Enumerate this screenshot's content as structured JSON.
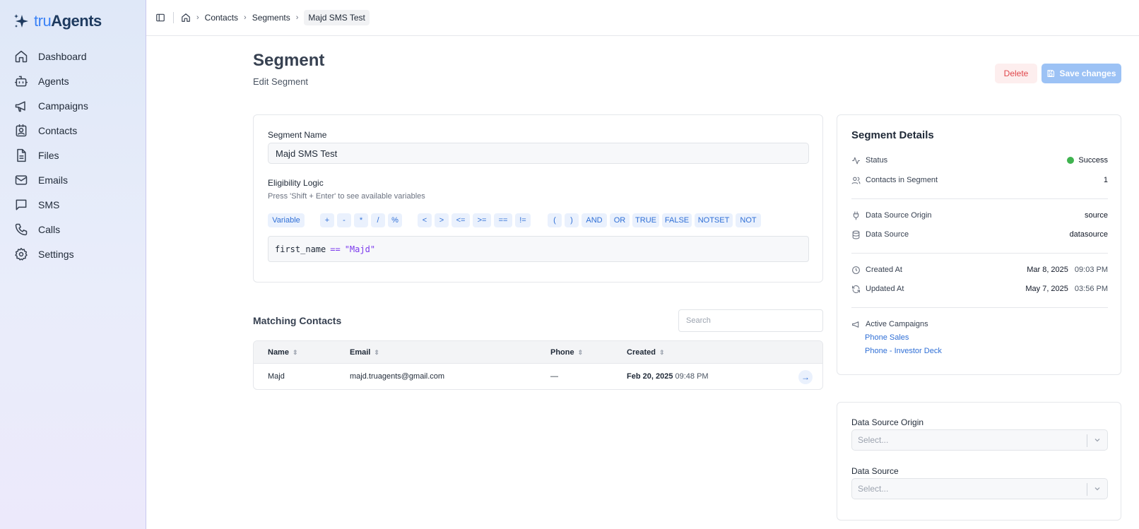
{
  "brand": {
    "tru": "tru",
    "agents": "Agents"
  },
  "nav": [
    {
      "label": "Dashboard",
      "icon": "home-icon"
    },
    {
      "label": "Agents",
      "icon": "bot-icon"
    },
    {
      "label": "Campaigns",
      "icon": "megaphone-icon"
    },
    {
      "label": "Contacts",
      "icon": "contact-card-icon"
    },
    {
      "label": "Files",
      "icon": "file-icon"
    },
    {
      "label": "Emails",
      "icon": "mail-icon"
    },
    {
      "label": "SMS",
      "icon": "message-icon"
    },
    {
      "label": "Calls",
      "icon": "phone-icon"
    },
    {
      "label": "Settings",
      "icon": "gear-icon"
    }
  ],
  "breadcrumb": {
    "contacts": "Contacts",
    "segments": "Segments",
    "current": "Majd SMS Test"
  },
  "header": {
    "title": "Segment",
    "subtitle": "Edit Segment",
    "delete_label": "Delete",
    "save_label": "Save changes"
  },
  "form": {
    "name_label": "Segment Name",
    "name_value": "Majd SMS Test",
    "logic_label": "Eligibility Logic",
    "logic_hint": "Press 'Shift + Enter' to see available variables",
    "tokens": [
      "Variable",
      "+",
      "-",
      "*",
      "/",
      "%",
      "<",
      ">",
      "<=",
      ">=",
      "==",
      "!=",
      "(",
      ")",
      "AND",
      "OR",
      "TRUE",
      "FALSE",
      "NOTSET",
      "NOT"
    ],
    "code": {
      "var": "first_name",
      "op": "==",
      "str": "\"Majd\""
    }
  },
  "contacts": {
    "title": "Matching Contacts",
    "search_placeholder": "Search",
    "columns": {
      "name": "Name",
      "email": "Email",
      "phone": "Phone",
      "created": "Created"
    },
    "rows": [
      {
        "name": "Majd",
        "email": "majd.truagents@gmail.com",
        "phone": "—",
        "created_date": "Feb 20, 2025",
        "created_time": "09:48 PM"
      }
    ]
  },
  "details": {
    "title": "Segment Details",
    "status_label": "Status",
    "status_value": "Success",
    "status_color": "#3fb34f",
    "count_label": "Contacts in Segment",
    "count_value": "1",
    "origin_label": "Data Source Origin",
    "origin_value": "source",
    "source_label": "Data Source",
    "source_value": "datasource",
    "created_label": "Created At",
    "created_date": "Mar 8, 2025",
    "created_time": "09:03 PM",
    "updated_label": "Updated At",
    "updated_date": "May 7, 2025",
    "updated_time": "03:56 PM",
    "campaigns_label": "Active Campaigns",
    "campaigns": [
      "Phone Sales",
      "Phone - Investor Deck"
    ]
  },
  "datasource": {
    "origin_label": "Data Source Origin",
    "origin_placeholder": "Select...",
    "source_label": "Data Source",
    "source_placeholder": "Select..."
  }
}
